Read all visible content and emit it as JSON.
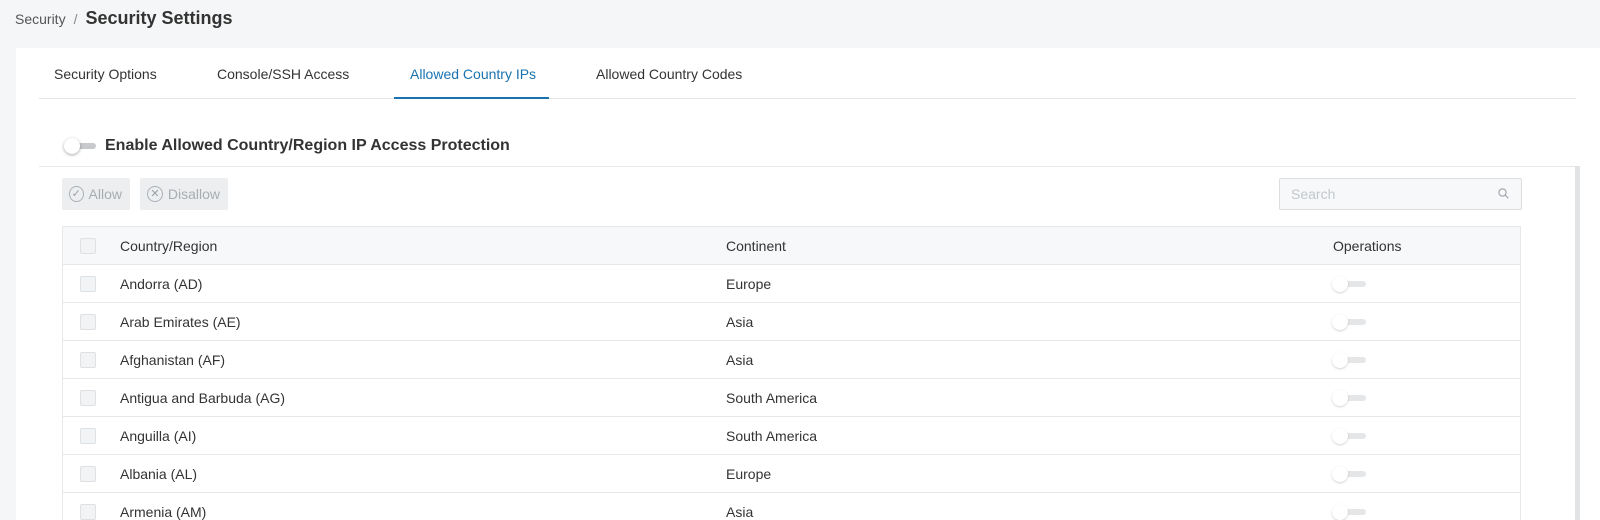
{
  "breadcrumb": {
    "parent": "Security",
    "separator": "/",
    "title": "Security Settings"
  },
  "tabs": [
    {
      "label": "Security Options",
      "active": false
    },
    {
      "label": "Console/SSH Access",
      "active": false
    },
    {
      "label": "Allowed Country IPs",
      "active": true
    },
    {
      "label": "Allowed Country Codes",
      "active": false
    }
  ],
  "protection": {
    "label": "Enable Allowed Country/Region IP Access Protection",
    "enabled": false
  },
  "toolbar": {
    "allow_label": "Allow",
    "allow_icon": "check-circle-icon",
    "disallow_label": "Disallow",
    "disallow_icon": "x-circle-icon"
  },
  "search": {
    "placeholder": "Search",
    "value": "",
    "icon": "search-icon"
  },
  "table": {
    "columns": [
      "Country/Region",
      "Continent",
      "Operations"
    ],
    "rows": [
      {
        "country": "Andorra (AD)",
        "continent": "Europe",
        "allowed": false
      },
      {
        "country": "Arab Emirates (AE)",
        "continent": "Asia",
        "allowed": false
      },
      {
        "country": "Afghanistan (AF)",
        "continent": "Asia",
        "allowed": false
      },
      {
        "country": "Antigua and Barbuda (AG)",
        "continent": "South America",
        "allowed": false
      },
      {
        "country": "Anguilla (AI)",
        "continent": "South America",
        "allowed": false
      },
      {
        "country": "Albania (AL)",
        "continent": "Europe",
        "allowed": false
      },
      {
        "country": "Armenia (AM)",
        "continent": "Asia",
        "allowed": false
      }
    ]
  },
  "colors": {
    "accent": "#1a73b0",
    "background": "#f5f6f7",
    "toggle_off": "#c7c9cc"
  }
}
